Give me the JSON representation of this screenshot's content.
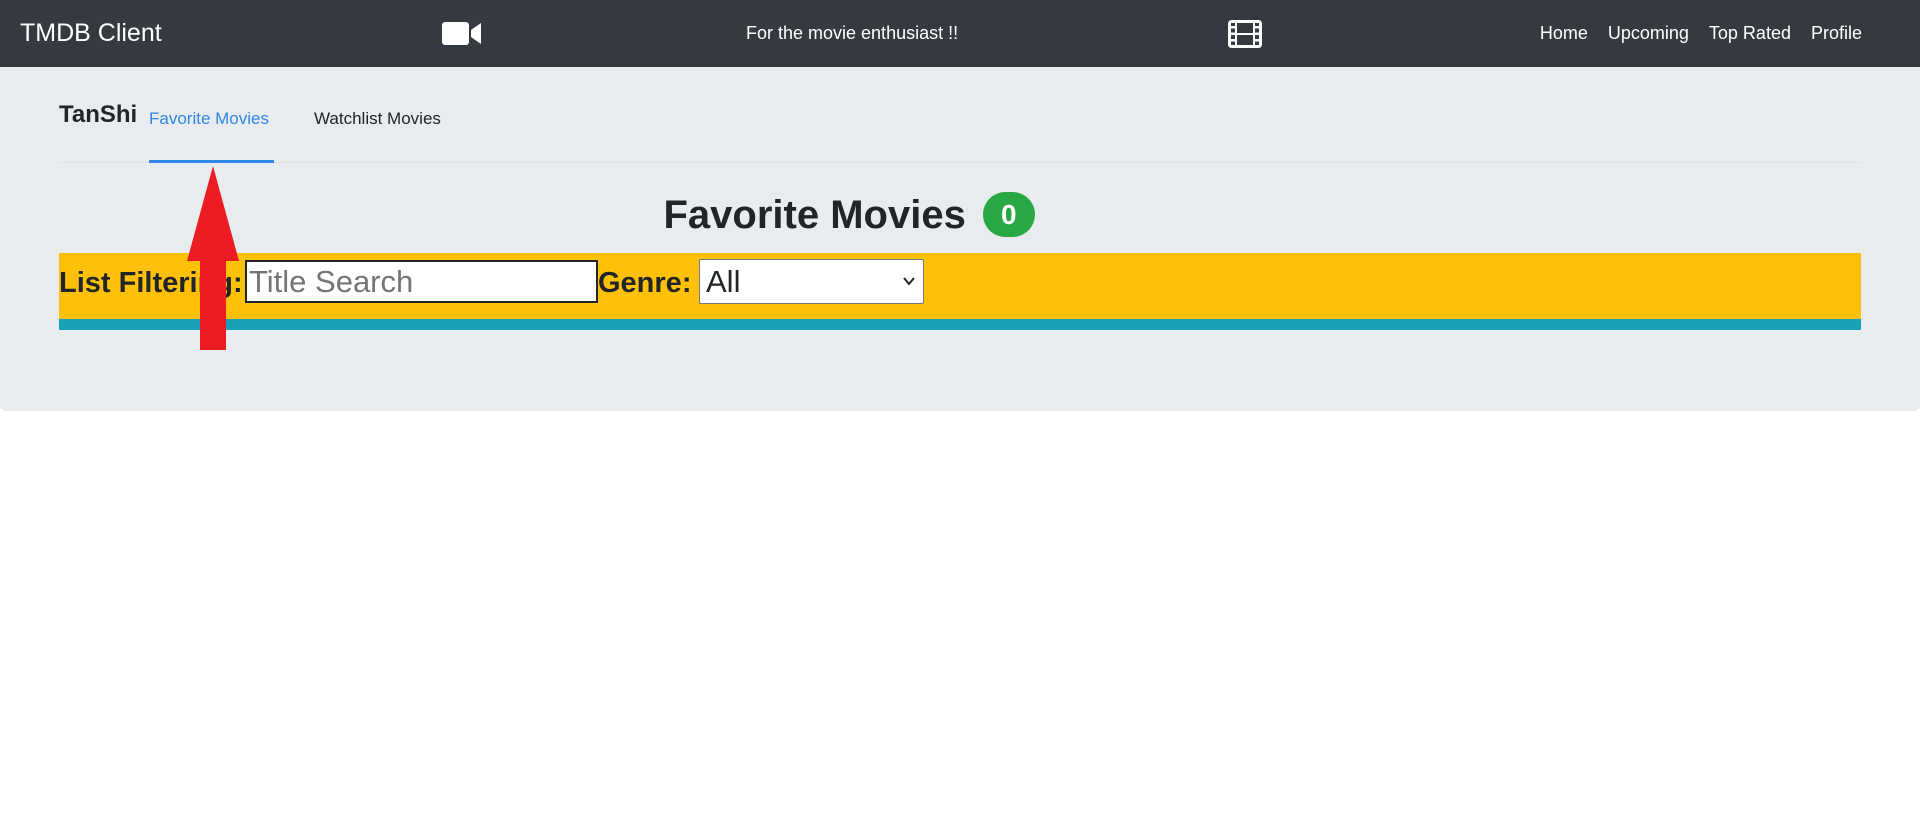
{
  "navbar": {
    "brand": "TMDB Client",
    "tagline": "For the movie enthusiast !!",
    "icons": [
      "video-camera-icon",
      "film-icon"
    ],
    "links": [
      "Home",
      "Upcoming",
      "Top Rated",
      "Profile"
    ]
  },
  "profile": {
    "username": "TanShi",
    "tabs": [
      {
        "label": "Favorite Movies",
        "active": true
      },
      {
        "label": "Watchlist Movies",
        "active": false
      }
    ]
  },
  "section": {
    "title": "Favorite Movies",
    "count": "0"
  },
  "filter": {
    "label": "List Filtering:",
    "search_placeholder": "Title Search",
    "search_value": "",
    "genre_label": "Genre:",
    "genre_selected": "All"
  },
  "colors": {
    "navbar_bg": "#343a40",
    "jumbotron_bg": "#e9ecef",
    "active_tab": "#2f86e6",
    "badge": "#28a745",
    "filter_bar": "#ffc107",
    "filter_strip": "#17a2b8",
    "annotation_arrow": "#ed1c24"
  }
}
